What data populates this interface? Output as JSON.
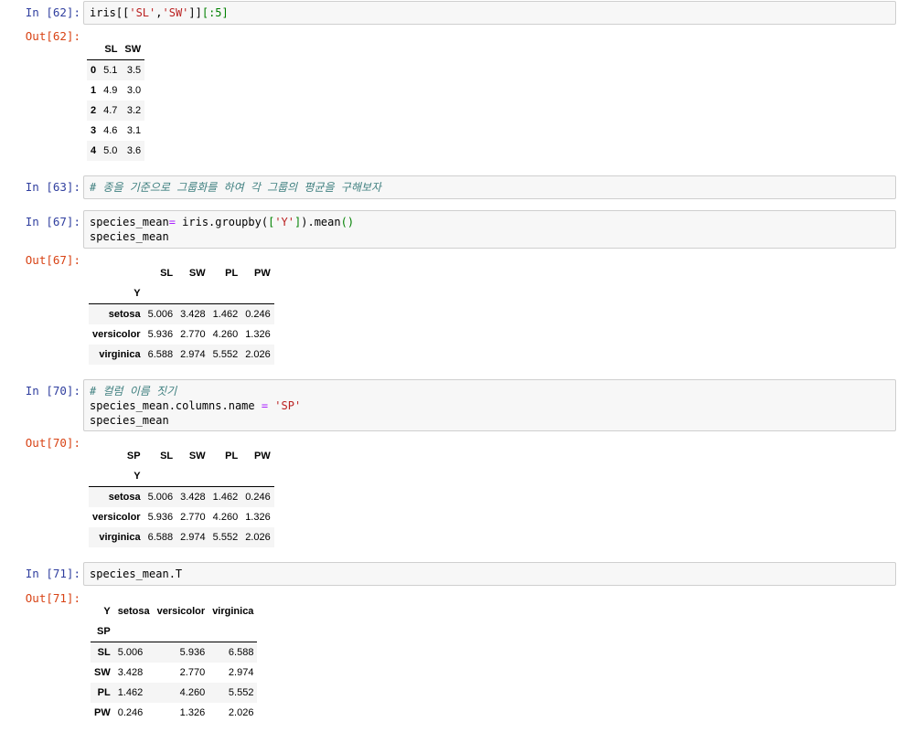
{
  "cells": [
    {
      "in_prompt": "In [62]:",
      "code": [
        [
          "iris[[",
          "'SL'",
          ",",
          "'SW'",
          "]]",
          "[:5]"
        ]
      ],
      "out_prompt": "Out[62]:",
      "table": {
        "columns": [
          "SL",
          "SW"
        ],
        "rows": [
          {
            "index": "0",
            "values": [
              "5.1",
              "3.5"
            ]
          },
          {
            "index": "1",
            "values": [
              "4.9",
              "3.0"
            ]
          },
          {
            "index": "2",
            "values": [
              "4.7",
              "3.2"
            ]
          },
          {
            "index": "3",
            "values": [
              "4.6",
              "3.1"
            ]
          },
          {
            "index": "4",
            "values": [
              "5.0",
              "3.6"
            ]
          }
        ]
      }
    },
    {
      "in_prompt": "In [63]:",
      "comment": "# 종을 기준으로 그룹화를 하여 각 그룹의 평균을 구해보자"
    },
    {
      "in_prompt": "In [67]:",
      "line1_a": "species_mean",
      "line1_op": "=",
      "line1_b": " iris.groupby(",
      "line1_c": "[",
      "line1_str": "'Y'",
      "line1_d": "]",
      "line1_e": ").mean",
      "line1_f": "()",
      "line2": "species_mean",
      "out_prompt": "Out[67]:",
      "table": {
        "columns_name": "",
        "columns": [
          "SL",
          "SW",
          "PL",
          "PW"
        ],
        "index_name": "Y",
        "rows": [
          {
            "index": "setosa",
            "values": [
              "5.006",
              "3.428",
              "1.462",
              "0.246"
            ]
          },
          {
            "index": "versicolor",
            "values": [
              "5.936",
              "2.770",
              "4.260",
              "1.326"
            ]
          },
          {
            "index": "virginica",
            "values": [
              "6.588",
              "2.974",
              "5.552",
              "2.026"
            ]
          }
        ]
      }
    },
    {
      "in_prompt": "In [70]:",
      "comment": "# 컬럼 이름 짓기",
      "line2_a": "species_mean.columns.name ",
      "line2_op": "=",
      "line2_str": " 'SP'",
      "line3": "species_mean",
      "out_prompt": "Out[70]:",
      "table": {
        "columns_name": "SP",
        "columns": [
          "SL",
          "SW",
          "PL",
          "PW"
        ],
        "index_name": "Y",
        "rows": [
          {
            "index": "setosa",
            "values": [
              "5.006",
              "3.428",
              "1.462",
              "0.246"
            ]
          },
          {
            "index": "versicolor",
            "values": [
              "5.936",
              "2.770",
              "4.260",
              "1.326"
            ]
          },
          {
            "index": "virginica",
            "values": [
              "6.588",
              "2.974",
              "5.552",
              "2.026"
            ]
          }
        ]
      }
    },
    {
      "in_prompt": "In [71]:",
      "code_text": "species_mean.T",
      "out_prompt": "Out[71]:",
      "table": {
        "columns_name": "Y",
        "columns": [
          "setosa",
          "versicolor",
          "virginica"
        ],
        "index_name": "SP",
        "rows": [
          {
            "index": "SL",
            "values": [
              "5.006",
              "5.936",
              "6.588"
            ]
          },
          {
            "index": "SW",
            "values": [
              "3.428",
              "2.770",
              "2.974"
            ]
          },
          {
            "index": "PL",
            "values": [
              "1.462",
              "4.260",
              "5.552"
            ]
          },
          {
            "index": "PW",
            "values": [
              "0.246",
              "1.326",
              "2.026"
            ]
          }
        ]
      }
    }
  ]
}
